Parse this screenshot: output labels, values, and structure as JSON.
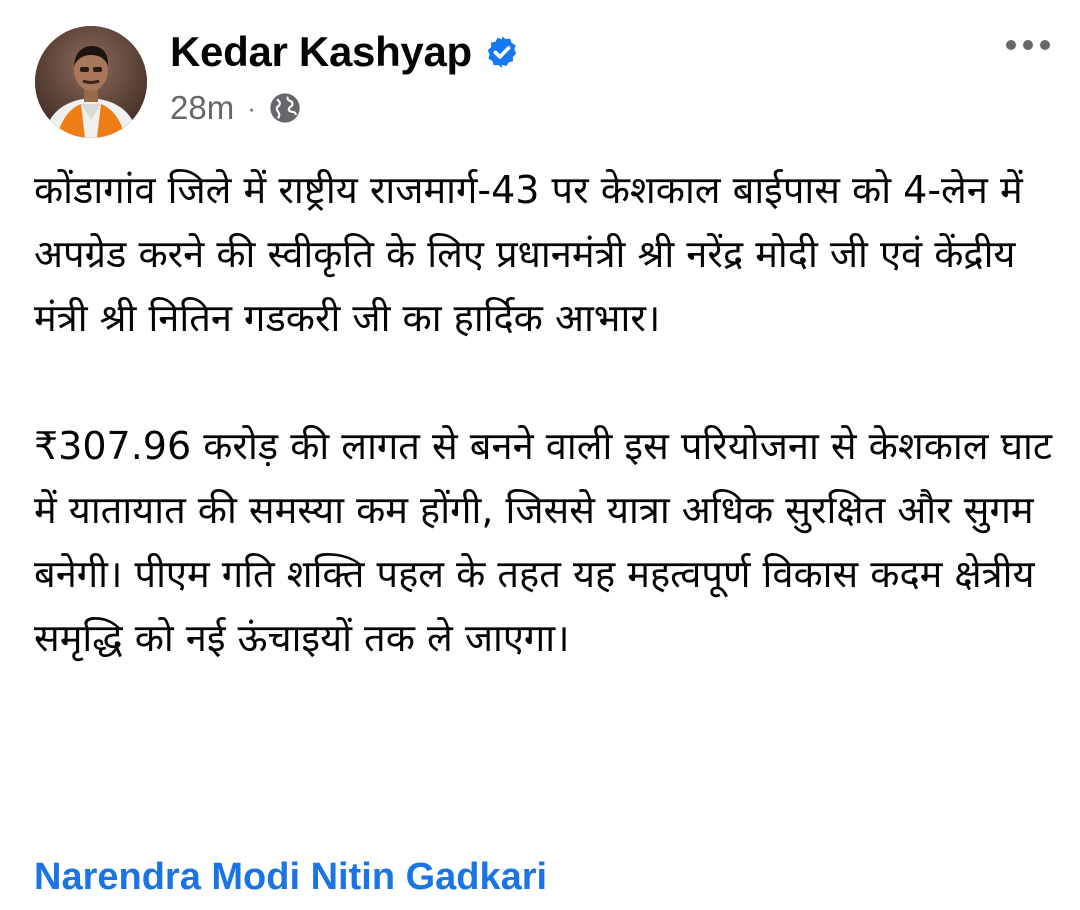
{
  "post": {
    "author": "Kedar Kashyap",
    "verified": true,
    "time": "28m",
    "separator": "·",
    "audience_icon": "globe-icon",
    "menu_icon": "more-options-icon",
    "paragraphs": [
      "कोंडागांव जिले में राष्ट्रीय राजमार्ग-43 पर केशकाल बाईपास को 4-लेन में अपग्रेड करने की स्वीकृति के लिए प्रधानमंत्री श्री नरेंद्र मोदी जी एवं केंद्रीय मंत्री श्री नितिन गडकरी जी का हार्दिक आभार।",
      "₹307.96 करोड़ की लागत से बनने वाली इस परियोजना से केशकाल घाट में यातायात की समस्या कम होंगी, जिससे यात्रा अधिक सुरक्षित और सुगम बनेगी। पीएम गति शक्ति पहल के तहत यह महत्वपूर्ण विकास कदम क्षेत्रीय समृद्धि को नई ऊंचाइयों तक ले जाएगा।"
    ],
    "tags": [
      "Narendra Modi",
      "Nitin Gadkari"
    ]
  },
  "colors": {
    "link": "#1b74e4",
    "verified": "#1877f2",
    "meta": "#65676b",
    "text": "#050505"
  }
}
